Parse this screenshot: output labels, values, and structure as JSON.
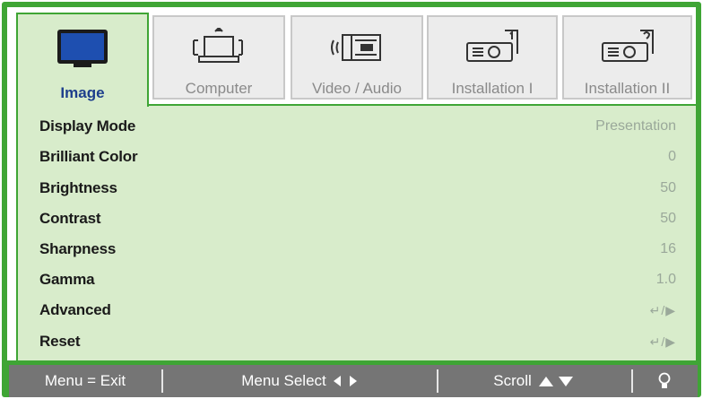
{
  "tabs": [
    {
      "label": "Image",
      "icon": "monitor-icon",
      "active": true
    },
    {
      "label": "Computer",
      "icon": "computer-icon",
      "active": false
    },
    {
      "label": "Video / Audio",
      "icon": "video-audio-icon",
      "active": false
    },
    {
      "label": "Installation I",
      "icon": "projector-icon",
      "active": false
    },
    {
      "label": "Installation II",
      "icon": "projector-help-icon",
      "active": false
    }
  ],
  "menu": {
    "items": [
      {
        "label": "Display Mode",
        "value": "Presentation"
      },
      {
        "label": "Brilliant Color",
        "value": "0"
      },
      {
        "label": "Brightness",
        "value": "50"
      },
      {
        "label": "Contrast",
        "value": "50"
      },
      {
        "label": "Sharpness",
        "value": "16"
      },
      {
        "label": "Gamma",
        "value": "1.0"
      },
      {
        "label": "Advanced",
        "value": "↵/▶"
      },
      {
        "label": "Reset",
        "value": "↵/▶"
      }
    ]
  },
  "statusbar": {
    "exit_label": "Menu = Exit",
    "select_label": "Menu Select",
    "scroll_label": "Scroll",
    "select_icon": "left-right-arrows-icon",
    "scroll_icon": "up-down-arrows-icon",
    "help_icon": "lightbulb-icon"
  },
  "colors": {
    "accent_green": "#3fa535",
    "panel_bg": "#d8eccb",
    "label_blue": "#1d3e8c",
    "status_gray": "#757575"
  }
}
